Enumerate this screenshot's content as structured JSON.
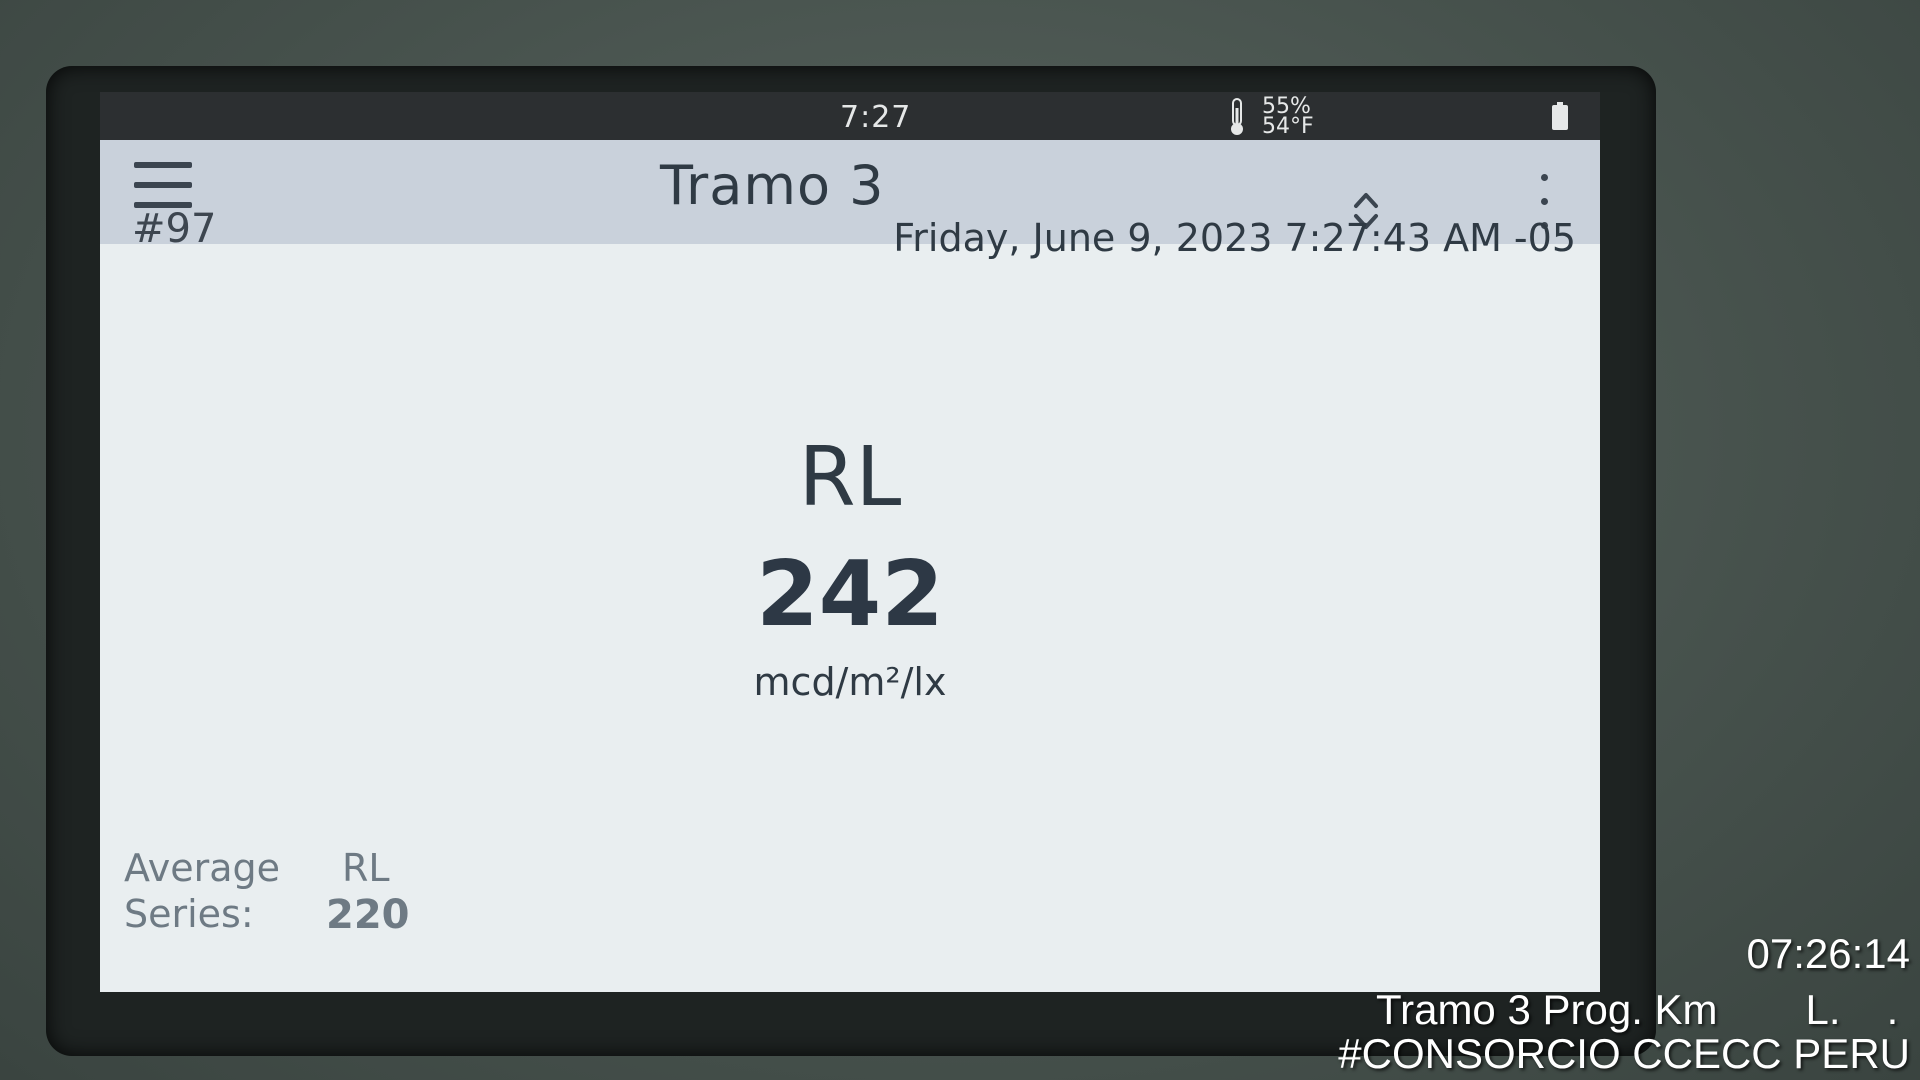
{
  "status_bar": {
    "time": "7:27",
    "humidity": "55%",
    "temperature": "54°F",
    "icons": [
      "thermometer-icon",
      "battery-icon"
    ]
  },
  "title_bar": {
    "title": "Tramo 3",
    "icons": [
      "menu-icon",
      "sort-icon",
      "more-vert-icon"
    ]
  },
  "measurement": {
    "record_number": "#97",
    "datetime": "Friday, June 9, 2023 7:27:43 AM -05",
    "label": "RL",
    "value": "242",
    "unit": "mcd/m²/lx"
  },
  "average": {
    "label_line1": "Average",
    "label_line2": "Series:",
    "metric": "RL",
    "value": "220"
  },
  "photo_overlay": {
    "time": "07:26:14",
    "line1_a": "Tramo 3 Prog. Km",
    "line1_b": "L.",
    "line1_c": ".",
    "line2": "#CONSORCIO CCECC PERU"
  },
  "colors": {
    "screen_bg": "#e9eef0",
    "title_bar_bg": "#c9d1db",
    "status_bar_bg": "#2c2f31",
    "text_dark": "#2f3a44",
    "text_muted": "#6e7a84"
  }
}
